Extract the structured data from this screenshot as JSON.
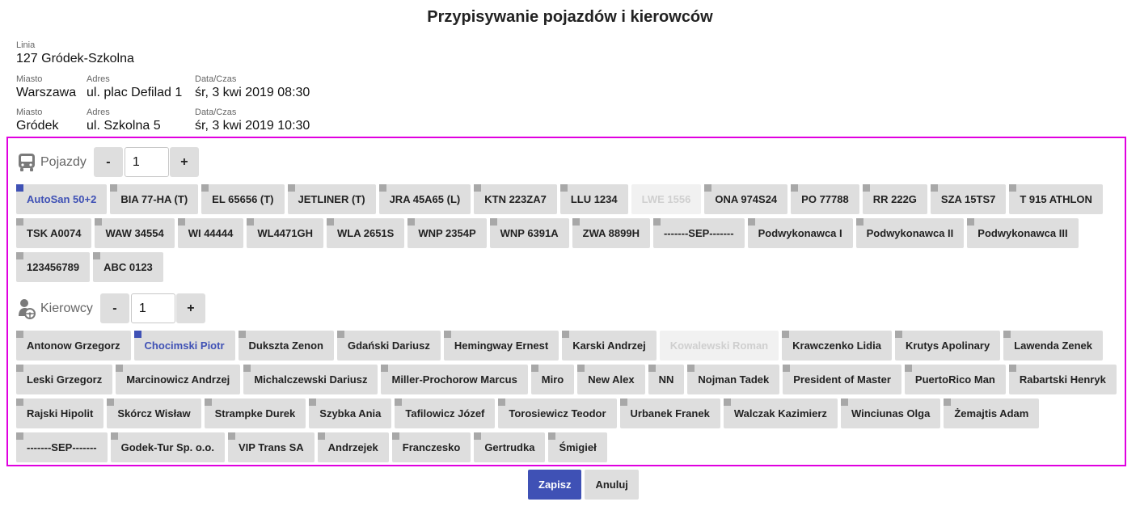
{
  "title": "Przypisywanie pojazdów i kierowców",
  "line": {
    "label": "Linia",
    "value": "127 Gródek-Szkolna"
  },
  "stops": [
    {
      "city_label": "Miasto",
      "city": "Warszawa",
      "address_label": "Adres",
      "address": "ul. plac Defilad 1",
      "datetime_label": "Data/Czas",
      "datetime": "śr, 3 kwi 2019 08:30"
    },
    {
      "city_label": "Miasto",
      "city": "Gródek",
      "address_label": "Adres",
      "address": "ul. Szkolna 5",
      "datetime_label": "Data/Czas",
      "datetime": "śr, 3 kwi 2019 10:30"
    }
  ],
  "vehicles": {
    "label": "Pojazdy",
    "icon": "bus-icon",
    "minus": "-",
    "plus": "+",
    "count": "1",
    "items": [
      {
        "label": "AutoSan 50+2",
        "state": "selected"
      },
      {
        "label": "BIA 77-HA (T)",
        "state": "normal"
      },
      {
        "label": "EL 65656 (T)",
        "state": "normal"
      },
      {
        "label": "JETLINER (T)",
        "state": "normal"
      },
      {
        "label": "JRA 45A65 (L)",
        "state": "normal"
      },
      {
        "label": "KTN 223ZA7",
        "state": "normal"
      },
      {
        "label": "LLU 1234",
        "state": "normal"
      },
      {
        "label": "LWE 1556",
        "state": "disabled"
      },
      {
        "label": "ONA 974S24",
        "state": "normal"
      },
      {
        "label": "PO 77788",
        "state": "normal"
      },
      {
        "label": "RR 222G",
        "state": "normal"
      },
      {
        "label": "SZA 15TS7",
        "state": "normal"
      },
      {
        "label": "T 915 ATHLON",
        "state": "normal"
      },
      {
        "label": "TSK A0074",
        "state": "normal"
      },
      {
        "label": "WAW 34554",
        "state": "normal"
      },
      {
        "label": "WI 44444",
        "state": "normal"
      },
      {
        "label": "WL4471GH",
        "state": "normal"
      },
      {
        "label": "WLA 2651S",
        "state": "normal"
      },
      {
        "label": "WNP 2354P",
        "state": "normal"
      },
      {
        "label": "WNP 6391A",
        "state": "normal"
      },
      {
        "label": "ZWA 8899H",
        "state": "normal"
      },
      {
        "label": "-------SEP-------",
        "state": "normal"
      },
      {
        "label": "Podwykonawca I",
        "state": "normal"
      },
      {
        "label": "Podwykonawca II",
        "state": "normal"
      },
      {
        "label": "Podwykonawca III",
        "state": "normal"
      },
      {
        "label": "123456789",
        "state": "normal"
      },
      {
        "label": "ABC 0123",
        "state": "normal"
      }
    ]
  },
  "drivers": {
    "label": "Kierowcy",
    "icon": "driver-icon",
    "minus": "-",
    "plus": "+",
    "count": "1",
    "items": [
      {
        "label": "Antonow Grzegorz",
        "state": "normal"
      },
      {
        "label": "Chocimski Piotr",
        "state": "selected"
      },
      {
        "label": "Dukszta Zenon",
        "state": "normal"
      },
      {
        "label": "Gdański Dariusz",
        "state": "normal"
      },
      {
        "label": "Hemingway Ernest",
        "state": "normal"
      },
      {
        "label": "Karski Andrzej",
        "state": "normal"
      },
      {
        "label": "Kowalewski Roman",
        "state": "disabled"
      },
      {
        "label": "Krawczenko Lidia",
        "state": "normal"
      },
      {
        "label": "Krutys Apolinary",
        "state": "normal"
      },
      {
        "label": "Lawenda Zenek",
        "state": "normal"
      },
      {
        "label": "Leski Grzegorz",
        "state": "normal"
      },
      {
        "label": "Marcinowicz Andrzej",
        "state": "normal"
      },
      {
        "label": "Michalczewski Dariusz",
        "state": "normal"
      },
      {
        "label": "Miller-Prochorow Marcus",
        "state": "normal"
      },
      {
        "label": "Miro",
        "state": "normal"
      },
      {
        "label": "New Alex",
        "state": "normal"
      },
      {
        "label": "NN",
        "state": "normal"
      },
      {
        "label": "Nojman Tadek",
        "state": "normal"
      },
      {
        "label": "President of Master",
        "state": "normal"
      },
      {
        "label": "PuertoRico Man",
        "state": "normal"
      },
      {
        "label": "Rabartski Henryk",
        "state": "normal"
      },
      {
        "label": "Rajski Hipolit",
        "state": "normal"
      },
      {
        "label": "Skórcz Wisław",
        "state": "normal"
      },
      {
        "label": "Strampke Durek",
        "state": "normal"
      },
      {
        "label": "Szybka Ania",
        "state": "normal"
      },
      {
        "label": "Tafilowicz Józef",
        "state": "normal"
      },
      {
        "label": "Torosiewicz Teodor",
        "state": "normal"
      },
      {
        "label": "Urbanek Franek",
        "state": "normal"
      },
      {
        "label": "Walczak Kazimierz",
        "state": "normal"
      },
      {
        "label": "Winciunas Olga",
        "state": "normal"
      },
      {
        "label": "Żemajtis Adam",
        "state": "normal"
      },
      {
        "label": "-------SEP-------",
        "state": "normal"
      },
      {
        "label": "Godek-Tur Sp. o.o.",
        "state": "normal"
      },
      {
        "label": "VIP Trans SA",
        "state": "normal"
      },
      {
        "label": "Andrzejek",
        "state": "normal"
      },
      {
        "label": "Franczesko",
        "state": "normal"
      },
      {
        "label": "Gertrudka",
        "state": "normal"
      },
      {
        "label": "Śmigieł",
        "state": "normal"
      }
    ]
  },
  "actions": {
    "save": "Zapisz",
    "cancel": "Anuluj"
  },
  "colors": {
    "accent": "#3f51b5",
    "panel_border": "#e000e0",
    "chip_bg": "#dedede"
  }
}
